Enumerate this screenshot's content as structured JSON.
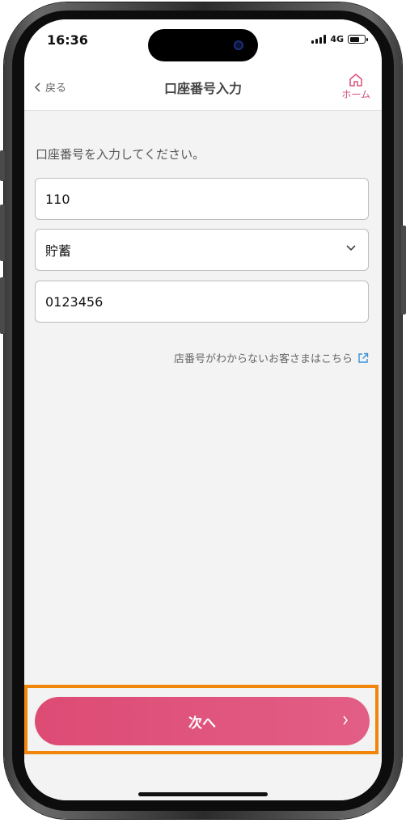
{
  "status": {
    "time": "16:36",
    "network": "4G",
    "battery_level": 0.7
  },
  "nav": {
    "back_label": "戻る",
    "title": "口座番号入力",
    "home_label": "ホーム"
  },
  "form": {
    "instruction": "口座番号を入力してください。",
    "branch_value": "110",
    "account_type": "貯蓄",
    "account_number": "0123456"
  },
  "help_link": "店番号がわからないお客さまはこちら",
  "next_button": "次へ",
  "colors": {
    "accent": "#d94f78",
    "highlight": "#f2860a"
  }
}
